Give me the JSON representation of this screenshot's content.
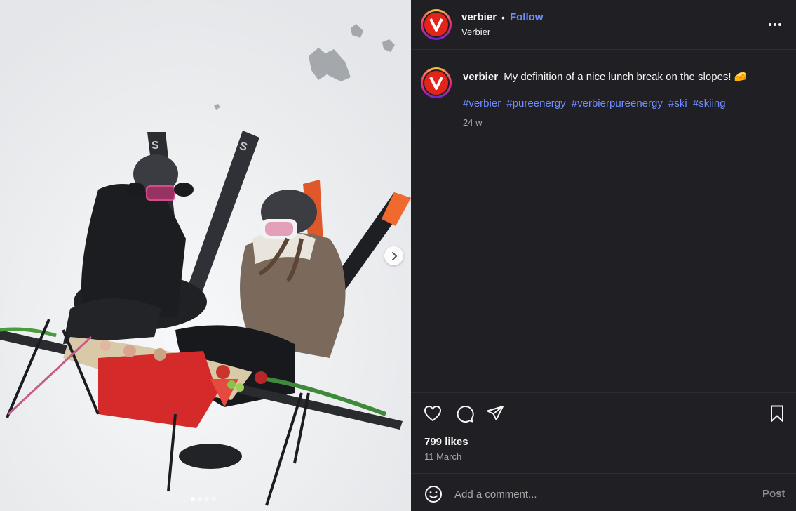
{
  "post": {
    "account": {
      "username": "verbier",
      "separator": "•",
      "follow_label": "Follow",
      "subtitle": "Verbier",
      "avatar_letter": "V",
      "brand_color": "#e3241b"
    },
    "caption": {
      "username": "verbier",
      "text": "My definition of a nice lunch break on the slopes! 🧀",
      "hashtags": [
        "#verbier",
        "#pureenergy",
        "#verbierpureenergy",
        "#ski",
        "#skiing"
      ],
      "time": "24 w"
    },
    "likes": "799 likes",
    "date": "11 March",
    "comment_placeholder": "Add a comment...",
    "post_label": "Post",
    "carousel": {
      "slides": 4,
      "active_index": 0
    }
  },
  "colors": {
    "panel_bg": "#1f1f24",
    "link_blue": "#708dff",
    "muted_text": "#a8a8a8"
  },
  "icons": {
    "more": "more-horizontal-icon",
    "like": "heart-icon",
    "comment": "comment-bubble-icon",
    "share": "paper-plane-icon",
    "save": "bookmark-icon",
    "emoji": "smiley-icon",
    "next": "chevron-right-icon"
  }
}
